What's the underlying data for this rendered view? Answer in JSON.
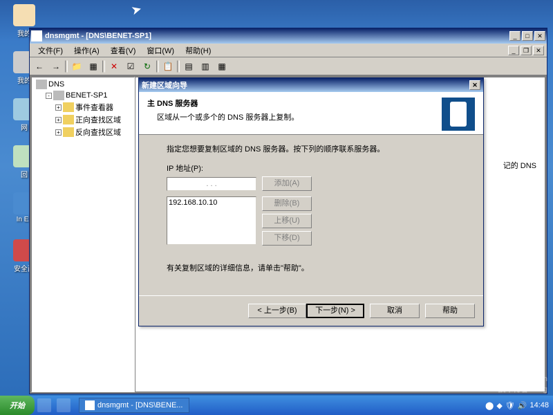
{
  "desktop": {
    "icons": [
      "我的",
      "我的",
      "网",
      "回",
      "In Ex",
      "安全西"
    ]
  },
  "mmc": {
    "title": "dnsmgmt - [DNS\\BENET-SP1]",
    "menus": [
      "文件(F)",
      "操作(A)",
      "查看(V)",
      "窗口(W)",
      "帮助(H)"
    ],
    "tree": {
      "root": "DNS",
      "server": "BENET-SP1",
      "nodes": [
        "事件查看器",
        "正向查找区域",
        "反向查找区域"
      ]
    },
    "rightnote": "记的 DNS"
  },
  "wizard": {
    "title": "新建区域向导",
    "header_main": "主 DNS 服务器",
    "header_sub": "区域从一个或多个的 DNS 服务器上复制。",
    "instruction": "指定您想要复制区域的 DNS 服务器。按下列的顺序联系服务器。",
    "ip_label": "IP 地址(P):",
    "ip_dots": ". . .",
    "btn_add": "添加(A)",
    "btn_remove": "删除(B)",
    "btn_up": "上移(U)",
    "btn_down": "下移(D)",
    "ip_list": [
      "192.168.10.10"
    ],
    "help_line": "有关复制区域的详细信息，请单击\"帮助\"。",
    "btn_back": "< 上一步(B)",
    "btn_next": "下一步(N) >",
    "btn_cancel": "取消",
    "btn_help": "帮助"
  },
  "taskbar": {
    "start": "开始",
    "task": "dnsmgmt - [DNS\\BENE...",
    "clock": "14:48"
  },
  "watermark": {
    "l1": "51CTO.com",
    "l2": "技术博客 Blog"
  }
}
